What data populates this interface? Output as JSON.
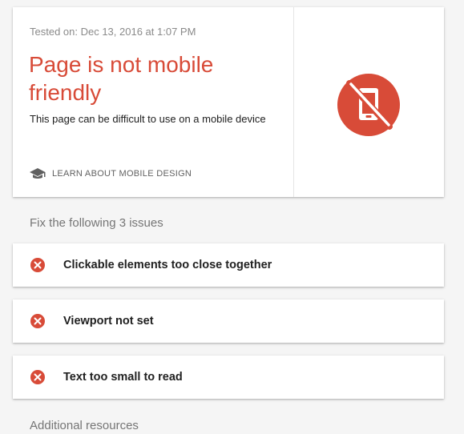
{
  "result": {
    "tested_on": "Tested on: Dec 13, 2016 at 1:07 PM",
    "title": "Page is not mobile friendly",
    "description": "This page can be difficult to use on a mobile device",
    "learn_link_label": "LEARN ABOUT MOBILE DESIGN",
    "learn_link_icon": "graduation-cap-icon",
    "verdict_icon": "not-mobile-friendly-icon",
    "accent_color": "#d84b38"
  },
  "issues": {
    "heading": "Fix the following 3 issues",
    "icon": "error-circle-icon",
    "items": [
      {
        "label": "Clickable elements too close together"
      },
      {
        "label": "Viewport not set"
      },
      {
        "label": "Text too small to read"
      }
    ]
  },
  "resources": {
    "heading": "Additional resources"
  }
}
